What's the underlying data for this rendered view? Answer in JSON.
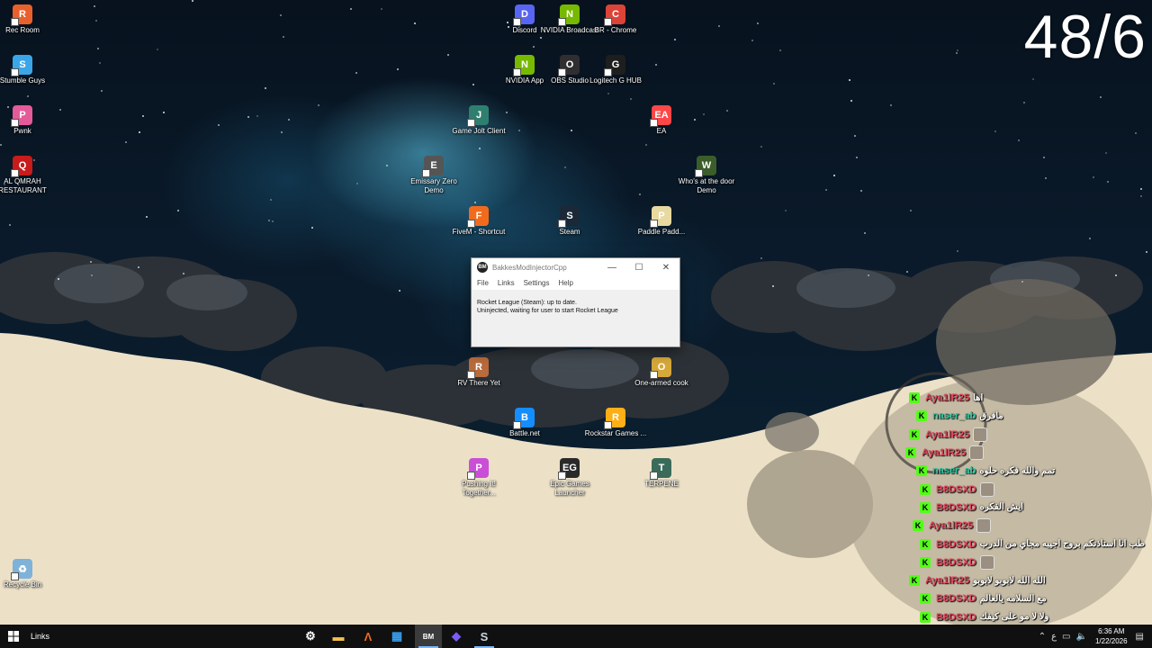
{
  "overlay": {
    "counter": "48/6"
  },
  "desktop": {
    "icons": [
      {
        "label": "Rec Room",
        "color": "#e8612c",
        "glyph": "R"
      },
      {
        "label": "Stumble Guys",
        "color": "#3aa6e8",
        "glyph": "S"
      },
      {
        "label": "Pwnk",
        "color": "#e55b9a",
        "glyph": "P"
      },
      {
        "label": "AL QMRAH RESTAURANT",
        "color": "#c81b1b",
        "glyph": "Q"
      },
      {
        "label": "Discord",
        "color": "#5865f2",
        "glyph": "D"
      },
      {
        "label": "NVIDIA Broadcast",
        "color": "#76b900",
        "glyph": "N"
      },
      {
        "label": "BR - Chrome",
        "color": "#db4437",
        "glyph": "C"
      },
      {
        "label": "NVIDIA App",
        "color": "#76b900",
        "glyph": "N"
      },
      {
        "label": "OBS Studio",
        "color": "#302e31",
        "glyph": "O"
      },
      {
        "label": "Logitech G HUB",
        "color": "#1e1e1e",
        "glyph": "G"
      },
      {
        "label": "Game Jolt Client",
        "color": "#2f7f6f",
        "glyph": "J"
      },
      {
        "label": "EA",
        "color": "#ff4747",
        "glyph": "EA"
      },
      {
        "label": "Emissary Zero Demo",
        "color": "#555555",
        "glyph": "E"
      },
      {
        "label": "Who's at the door Demo",
        "color": "#3b5d2a",
        "glyph": "W"
      },
      {
        "label": "FiveM - Shortcut",
        "color": "#f26b1d",
        "glyph": "F"
      },
      {
        "label": "Steam",
        "color": "#1b2838",
        "glyph": "S"
      },
      {
        "label": "Paddle Padd...",
        "color": "#e8d9a0",
        "glyph": "P"
      },
      {
        "label": "RV There Yet",
        "color": "#b86b3c",
        "glyph": "R"
      },
      {
        "label": "One-armed cook",
        "color": "#d6a83a",
        "glyph": "O"
      },
      {
        "label": "Battle.net",
        "color": "#148eff",
        "glyph": "B"
      },
      {
        "label": "Rockstar Games ...",
        "color": "#fcaf17",
        "glyph": "R"
      },
      {
        "label": "Pushing It! Together...",
        "color": "#c94fd6",
        "glyph": "P"
      },
      {
        "label": "Epic Games Launcher",
        "color": "#2a2a2a",
        "glyph": "EG"
      },
      {
        "label": "TERPENE",
        "color": "#3a6b5a",
        "glyph": "T"
      },
      {
        "label": "Recycle Bin",
        "color": "#7fb2d8",
        "glyph": "♻"
      }
    ]
  },
  "app_window": {
    "title": "BakkesModInjectorCpp",
    "logo": "BM",
    "menu": [
      "File",
      "Links",
      "Settings",
      "Help"
    ],
    "status_line1": "Rocket League (Steam): up to date.",
    "status_line2": "Uninjected, waiting for user to start Rocket League",
    "minimize": "—",
    "maximize": "☐",
    "close": "✕"
  },
  "chat": {
    "badge": "K",
    "messages": [
      {
        "user": "Aya1lR25",
        "text": "اها",
        "color": "#e0455c",
        "avatar": false
      },
      {
        "user": "naser_ab",
        "text": "مافرق",
        "color": "#2ec4a0",
        "avatar": false
      },
      {
        "user": "Aya1lR25",
        "text": "",
        "color": "#e0455c",
        "avatar": true
      },
      {
        "user": "Aya1lR25",
        "text": "",
        "color": "#e0455c",
        "avatar": true
      },
      {
        "user": "naser_ab",
        "text": "تمم والله فكره حلوه",
        "color": "#2ec4a0",
        "avatar": false
      },
      {
        "user": "B8DSXD",
        "text": "",
        "color": "#e0455c",
        "avatar": true
      },
      {
        "user": "B8DSXD",
        "text": "ايش الفكره",
        "color": "#e0455c",
        "avatar": false
      },
      {
        "user": "Aya1lR25",
        "text": "",
        "color": "#e0455c",
        "avatar": true
      },
      {
        "user": "B8DSXD",
        "text": "طب انا استاذنكم بروح اجيبه مجاي من الدرب",
        "color": "#e0455c",
        "avatar": false
      },
      {
        "user": "B8DSXD",
        "text": "",
        "color": "#e0455c",
        "avatar": true
      },
      {
        "user": "Aya1lR25",
        "text": "الله الله لابوبو لابوبو",
        "color": "#e0455c",
        "avatar": false
      },
      {
        "user": "B8DSXD",
        "text": "مع السلامه يالعالم",
        "color": "#e0455c",
        "avatar": false
      },
      {
        "user": "B8DSXD",
        "text": "ولا لا مو على كيفك",
        "color": "#e0455c",
        "avatar": false
      }
    ]
  },
  "taskbar": {
    "links_label": "Links",
    "apps": [
      {
        "name": "settings",
        "glyph": "⚙",
        "color": "#ffffff"
      },
      {
        "name": "file-explorer",
        "glyph": "▬",
        "color": "#f3c24b"
      },
      {
        "name": "fivem",
        "glyph": "Λ",
        "color": "#f26b1d"
      },
      {
        "name": "microsoft-store",
        "glyph": "▦",
        "color": "#3aa0f0"
      },
      {
        "name": "bakkesmod",
        "glyph": "BM",
        "color": "#ffffff"
      },
      {
        "name": "kick-app",
        "glyph": "◆",
        "color": "#7a5cf0"
      },
      {
        "name": "steam",
        "glyph": "S",
        "color": "#c7d5e0"
      }
    ],
    "tray_language": "ع",
    "time": "6:36 AM",
    "date": "1/22/2026"
  }
}
